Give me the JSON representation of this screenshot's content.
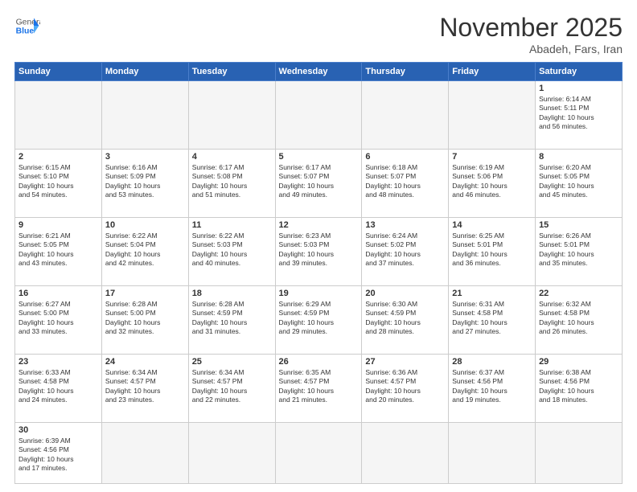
{
  "header": {
    "logo_general": "General",
    "logo_blue": "Blue",
    "month": "November 2025",
    "location": "Abadeh, Fars, Iran"
  },
  "weekdays": [
    "Sunday",
    "Monday",
    "Tuesday",
    "Wednesday",
    "Thursday",
    "Friday",
    "Saturday"
  ],
  "rows": [
    [
      {
        "day": "",
        "text": ""
      },
      {
        "day": "",
        "text": ""
      },
      {
        "day": "",
        "text": ""
      },
      {
        "day": "",
        "text": ""
      },
      {
        "day": "",
        "text": ""
      },
      {
        "day": "",
        "text": ""
      },
      {
        "day": "1",
        "text": "Sunrise: 6:14 AM\nSunset: 5:11 PM\nDaylight: 10 hours\nand 56 minutes."
      }
    ],
    [
      {
        "day": "2",
        "text": "Sunrise: 6:15 AM\nSunset: 5:10 PM\nDaylight: 10 hours\nand 54 minutes."
      },
      {
        "day": "3",
        "text": "Sunrise: 6:16 AM\nSunset: 5:09 PM\nDaylight: 10 hours\nand 53 minutes."
      },
      {
        "day": "4",
        "text": "Sunrise: 6:17 AM\nSunset: 5:08 PM\nDaylight: 10 hours\nand 51 minutes."
      },
      {
        "day": "5",
        "text": "Sunrise: 6:17 AM\nSunset: 5:07 PM\nDaylight: 10 hours\nand 49 minutes."
      },
      {
        "day": "6",
        "text": "Sunrise: 6:18 AM\nSunset: 5:07 PM\nDaylight: 10 hours\nand 48 minutes."
      },
      {
        "day": "7",
        "text": "Sunrise: 6:19 AM\nSunset: 5:06 PM\nDaylight: 10 hours\nand 46 minutes."
      },
      {
        "day": "8",
        "text": "Sunrise: 6:20 AM\nSunset: 5:05 PM\nDaylight: 10 hours\nand 45 minutes."
      }
    ],
    [
      {
        "day": "9",
        "text": "Sunrise: 6:21 AM\nSunset: 5:05 PM\nDaylight: 10 hours\nand 43 minutes."
      },
      {
        "day": "10",
        "text": "Sunrise: 6:22 AM\nSunset: 5:04 PM\nDaylight: 10 hours\nand 42 minutes."
      },
      {
        "day": "11",
        "text": "Sunrise: 6:22 AM\nSunset: 5:03 PM\nDaylight: 10 hours\nand 40 minutes."
      },
      {
        "day": "12",
        "text": "Sunrise: 6:23 AM\nSunset: 5:03 PM\nDaylight: 10 hours\nand 39 minutes."
      },
      {
        "day": "13",
        "text": "Sunrise: 6:24 AM\nSunset: 5:02 PM\nDaylight: 10 hours\nand 37 minutes."
      },
      {
        "day": "14",
        "text": "Sunrise: 6:25 AM\nSunset: 5:01 PM\nDaylight: 10 hours\nand 36 minutes."
      },
      {
        "day": "15",
        "text": "Sunrise: 6:26 AM\nSunset: 5:01 PM\nDaylight: 10 hours\nand 35 minutes."
      }
    ],
    [
      {
        "day": "16",
        "text": "Sunrise: 6:27 AM\nSunset: 5:00 PM\nDaylight: 10 hours\nand 33 minutes."
      },
      {
        "day": "17",
        "text": "Sunrise: 6:28 AM\nSunset: 5:00 PM\nDaylight: 10 hours\nand 32 minutes."
      },
      {
        "day": "18",
        "text": "Sunrise: 6:28 AM\nSunset: 4:59 PM\nDaylight: 10 hours\nand 31 minutes."
      },
      {
        "day": "19",
        "text": "Sunrise: 6:29 AM\nSunset: 4:59 PM\nDaylight: 10 hours\nand 29 minutes."
      },
      {
        "day": "20",
        "text": "Sunrise: 6:30 AM\nSunset: 4:59 PM\nDaylight: 10 hours\nand 28 minutes."
      },
      {
        "day": "21",
        "text": "Sunrise: 6:31 AM\nSunset: 4:58 PM\nDaylight: 10 hours\nand 27 minutes."
      },
      {
        "day": "22",
        "text": "Sunrise: 6:32 AM\nSunset: 4:58 PM\nDaylight: 10 hours\nand 26 minutes."
      }
    ],
    [
      {
        "day": "23",
        "text": "Sunrise: 6:33 AM\nSunset: 4:58 PM\nDaylight: 10 hours\nand 24 minutes."
      },
      {
        "day": "24",
        "text": "Sunrise: 6:34 AM\nSunset: 4:57 PM\nDaylight: 10 hours\nand 23 minutes."
      },
      {
        "day": "25",
        "text": "Sunrise: 6:34 AM\nSunset: 4:57 PM\nDaylight: 10 hours\nand 22 minutes."
      },
      {
        "day": "26",
        "text": "Sunrise: 6:35 AM\nSunset: 4:57 PM\nDaylight: 10 hours\nand 21 minutes."
      },
      {
        "day": "27",
        "text": "Sunrise: 6:36 AM\nSunset: 4:57 PM\nDaylight: 10 hours\nand 20 minutes."
      },
      {
        "day": "28",
        "text": "Sunrise: 6:37 AM\nSunset: 4:56 PM\nDaylight: 10 hours\nand 19 minutes."
      },
      {
        "day": "29",
        "text": "Sunrise: 6:38 AM\nSunset: 4:56 PM\nDaylight: 10 hours\nand 18 minutes."
      }
    ],
    [
      {
        "day": "30",
        "text": "Sunrise: 6:39 AM\nSunset: 4:56 PM\nDaylight: 10 hours\nand 17 minutes."
      },
      {
        "day": "",
        "text": ""
      },
      {
        "day": "",
        "text": ""
      },
      {
        "day": "",
        "text": ""
      },
      {
        "day": "",
        "text": ""
      },
      {
        "day": "",
        "text": ""
      },
      {
        "day": "",
        "text": ""
      }
    ]
  ]
}
